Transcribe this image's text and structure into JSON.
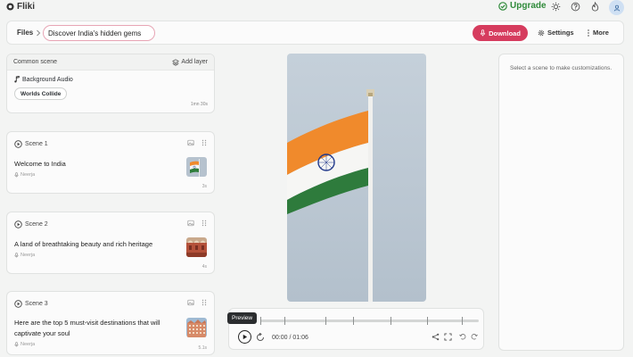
{
  "app": {
    "name": "Fliki"
  },
  "topbar": {
    "upgrade_label": "Upgrade",
    "accent": "#2f8a3a"
  },
  "filesbar": {
    "files_label": "Files",
    "title_value": "Discover India's hidden gems",
    "download_label": "Download",
    "settings_label": "Settings",
    "more_label": "More",
    "download_color": "#d63c5e"
  },
  "common_scene": {
    "title": "Common scene",
    "add_layer_label": "Add layer",
    "background_audio_label": "Background Audio",
    "track_chip": "Worlds Collide",
    "duration": "1mn 30s"
  },
  "scenes": [
    {
      "label": "Scene 1",
      "text": "Welcome to India",
      "voice": "Neerja",
      "duration": "3s",
      "thumb": "indian-flag"
    },
    {
      "label": "Scene 2",
      "text": "A land of breathtaking beauty and rich heritage",
      "voice": "Neerja",
      "duration": "4s",
      "thumb": "red-fort"
    },
    {
      "label": "Scene 3",
      "text": "Here are the top 5 must-visit destinations that will captivate your soul",
      "voice": "Neerja",
      "duration": "5.1s",
      "thumb": "hawa-mahal"
    }
  ],
  "player": {
    "tooltip": "Preview",
    "time": "00:00 / 01:06",
    "progress": 0
  },
  "right_panel": {
    "hint": "Select a scene to make customizations."
  }
}
